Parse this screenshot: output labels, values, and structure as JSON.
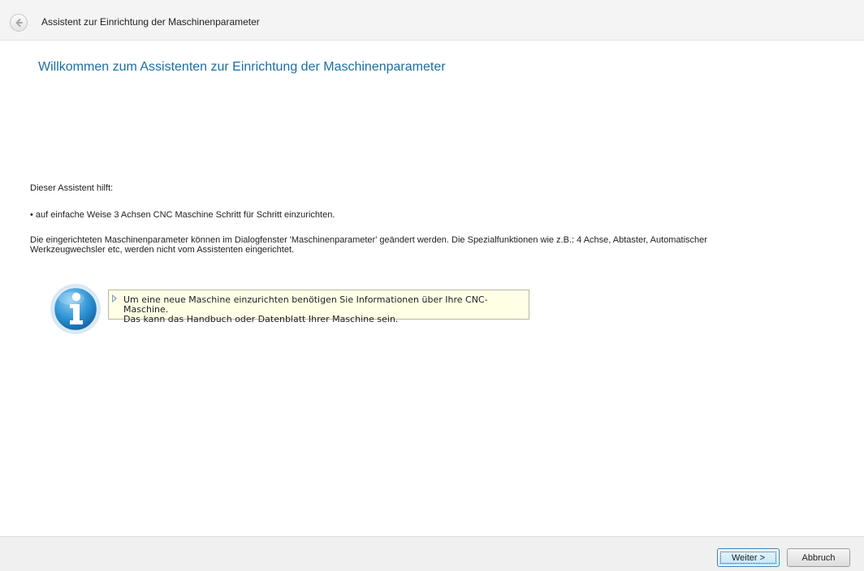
{
  "window": {
    "title": "Assistent zur Einrichtung der Maschinenparameter",
    "back_icon": "back-arrow-icon"
  },
  "main": {
    "heading": "Willkommen zum Assistenten zur Einrichtung der Maschinenparameter",
    "intro": "Dieser Assistent hilft:",
    "bullet": "• auf einfache Weise 3 Achsen CNC Maschine Schritt für Schritt einzurichten.",
    "paragraph": "Die eingerichteten Maschinenparameter können im Dialogfenster 'Maschinenparameter' geändert werden. Die Spezialfunktionen wie z.B.: 4 Achse, Abtaster, Automatischer\nWerkzeugwechsler etc, werden nicht vom Assistenten eingerichtet."
  },
  "info": {
    "icon": "info-icon",
    "text": "Um eine neue Maschine einzurichten benötigen Sie Informationen über Ihre CNC- Maschine.\nDas kann das Handbuch oder Datenblatt Ihrer Maschine sein."
  },
  "footer": {
    "next_label": "Weiter >",
    "cancel_label": "Abbruch"
  },
  "colors": {
    "heading": "#1c6ea4",
    "tip_background": "#ffffe6"
  }
}
